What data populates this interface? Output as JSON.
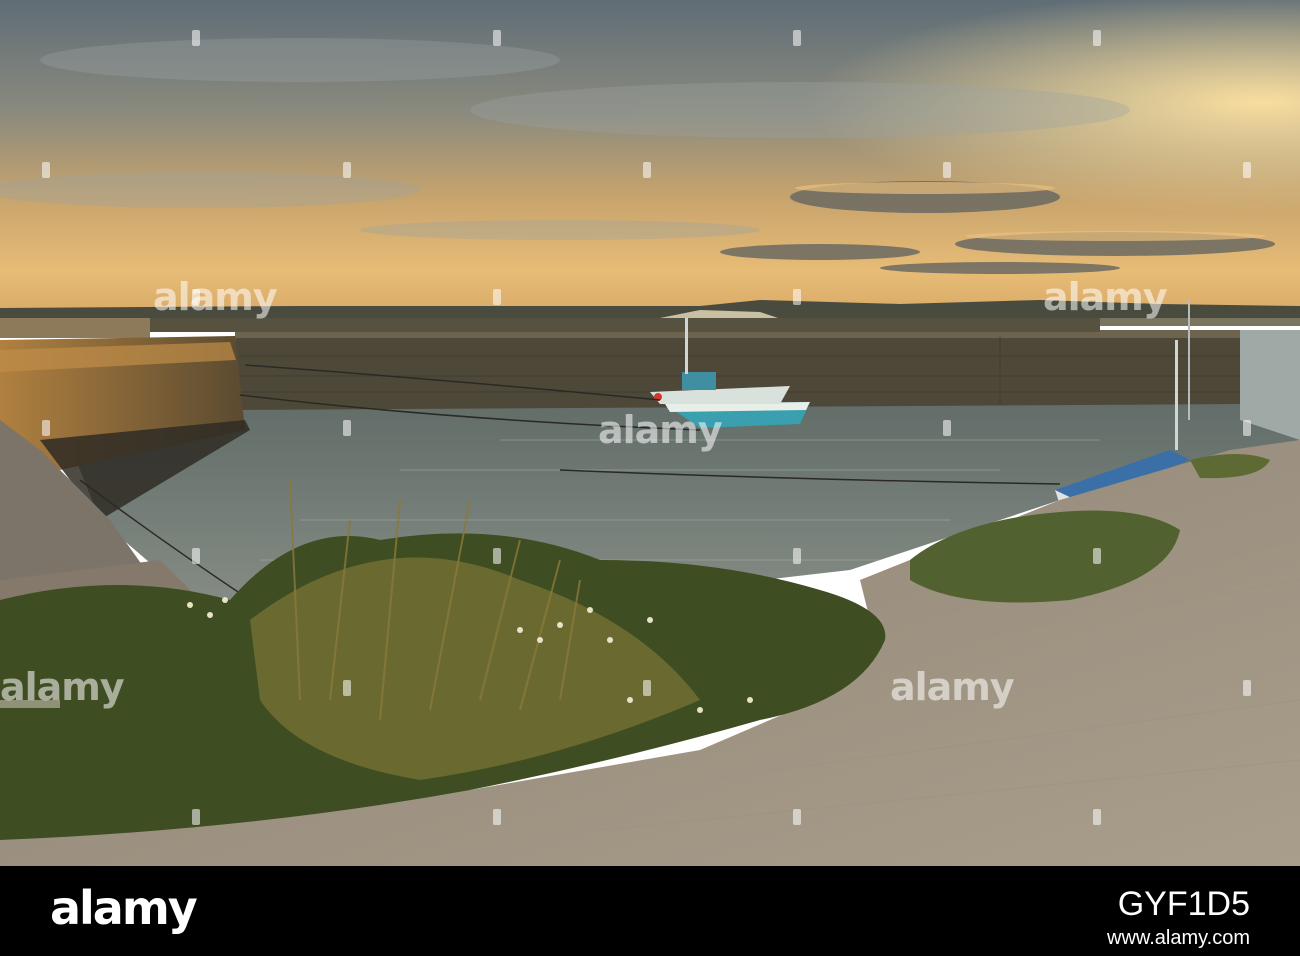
{
  "scene": {
    "description_colors": {
      "sky_top": "#6f7d86",
      "sky_mid": "#c9a773",
      "horizon_glow": "#f3c97e",
      "water": "#6c7a78",
      "wall": "#4f4a3d",
      "wall_lit": "#a7783c",
      "concrete": "#a89c8a",
      "grass": "#4c5a2a",
      "boat": "#3aa0b0"
    }
  },
  "watermark": {
    "text": "alamy"
  },
  "footer": {
    "logo": "alamy",
    "image_id": "GYF1D5",
    "site": "www.alamy.com"
  }
}
